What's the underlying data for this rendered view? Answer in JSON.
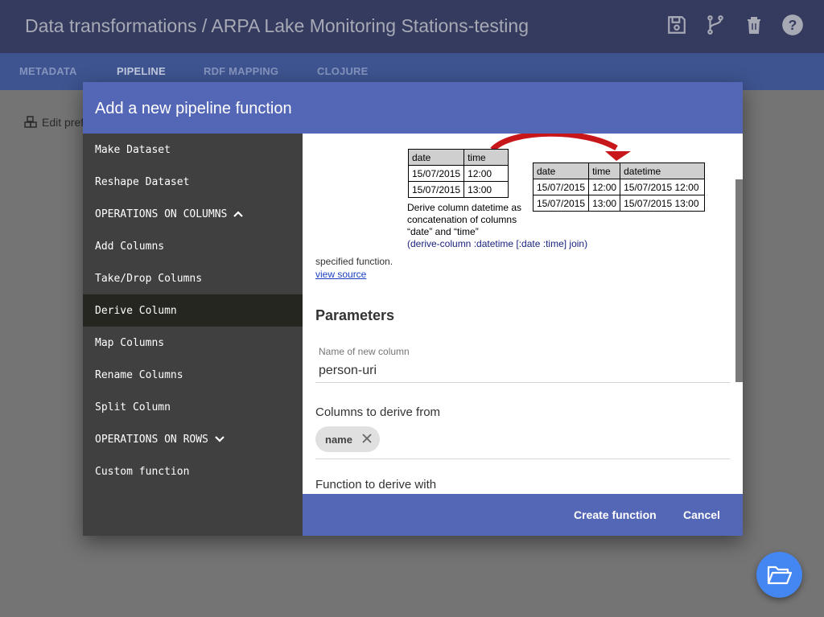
{
  "app": {
    "title": "Data transformations / ARPA Lake Monitoring Stations-testing",
    "icons": [
      "save-icon",
      "fork-icon",
      "delete-icon",
      "help-icon"
    ]
  },
  "tabs": [
    {
      "label": "METADATA",
      "active": false
    },
    {
      "label": "PIPELINE",
      "active": true
    },
    {
      "label": "RDF MAPPING",
      "active": false
    },
    {
      "label": "CLOJURE",
      "active": false
    }
  ],
  "background": {
    "edit_label": "Edit pref"
  },
  "dialog": {
    "title": "Add a new pipeline function",
    "sidebar": [
      {
        "label": "Make Dataset"
      },
      {
        "label": "Reshape Dataset"
      },
      {
        "label": "OPERATIONS ON COLUMNS",
        "chevron": "up"
      },
      {
        "label": "Add Columns"
      },
      {
        "label": "Take/Drop Columns"
      },
      {
        "label": "Derive Column",
        "active": true
      },
      {
        "label": "Map Columns"
      },
      {
        "label": "Rename Columns"
      },
      {
        "label": "Split Column"
      },
      {
        "label": "OPERATIONS ON ROWS",
        "chevron": "down"
      },
      {
        "label": "Custom function"
      }
    ],
    "example": {
      "input_table": {
        "headers": [
          "date",
          "time"
        ],
        "rows": [
          [
            "15/07/2015",
            "12:00"
          ],
          [
            "15/07/2015",
            "13:00"
          ]
        ]
      },
      "output_table": {
        "headers": [
          "date",
          "time",
          "datetime"
        ],
        "rows": [
          [
            "15/07/2015",
            "12:00",
            "15/07/2015 12:00"
          ],
          [
            "15/07/2015",
            "13:00",
            "15/07/2015 13:00"
          ]
        ]
      },
      "description": "Derive column datetime as concatenation of columns “date” and “time”",
      "code": "(derive-column :datetime [:date :time] join)"
    },
    "specified_text": "specified function.",
    "view_source": "view source",
    "parameters_heading": "Parameters",
    "new_column": {
      "label": "Name of new column",
      "value": "person-uri"
    },
    "columns_label": "Columns to derive from",
    "chips": [
      "name"
    ],
    "function_label": "Function to derive with",
    "buttons": {
      "create": "Create function",
      "cancel": "Cancel"
    }
  },
  "colors": {
    "appbar": "#343b5e",
    "tabbar": "#3e5490",
    "dialog_accent": "#5466b6",
    "sidebar": "#404040",
    "fab": "#4487f2"
  }
}
